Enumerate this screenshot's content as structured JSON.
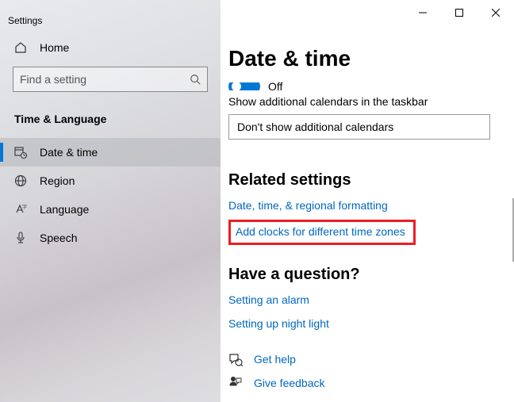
{
  "window": {
    "title": "Settings"
  },
  "sidebar": {
    "home_label": "Home",
    "search_placeholder": "Find a setting",
    "section_label": "Time & Language",
    "items": [
      {
        "label": "Date & time"
      },
      {
        "label": "Region"
      },
      {
        "label": "Language"
      },
      {
        "label": "Speech"
      }
    ]
  },
  "main": {
    "title": "Date & time",
    "toggle_off_partial": "Off",
    "calendars_label": "Show additional calendars in the taskbar",
    "calendars_value": "Don't show additional calendars",
    "related": {
      "title": "Related settings",
      "link1": "Date, time, & regional formatting",
      "link2": "Add clocks for different time zones"
    },
    "question": {
      "title": "Have a question?",
      "link1": "Setting an alarm",
      "link2": "Setting up night light"
    },
    "help": {
      "get_help": "Get help",
      "give_feedback": "Give feedback"
    }
  }
}
